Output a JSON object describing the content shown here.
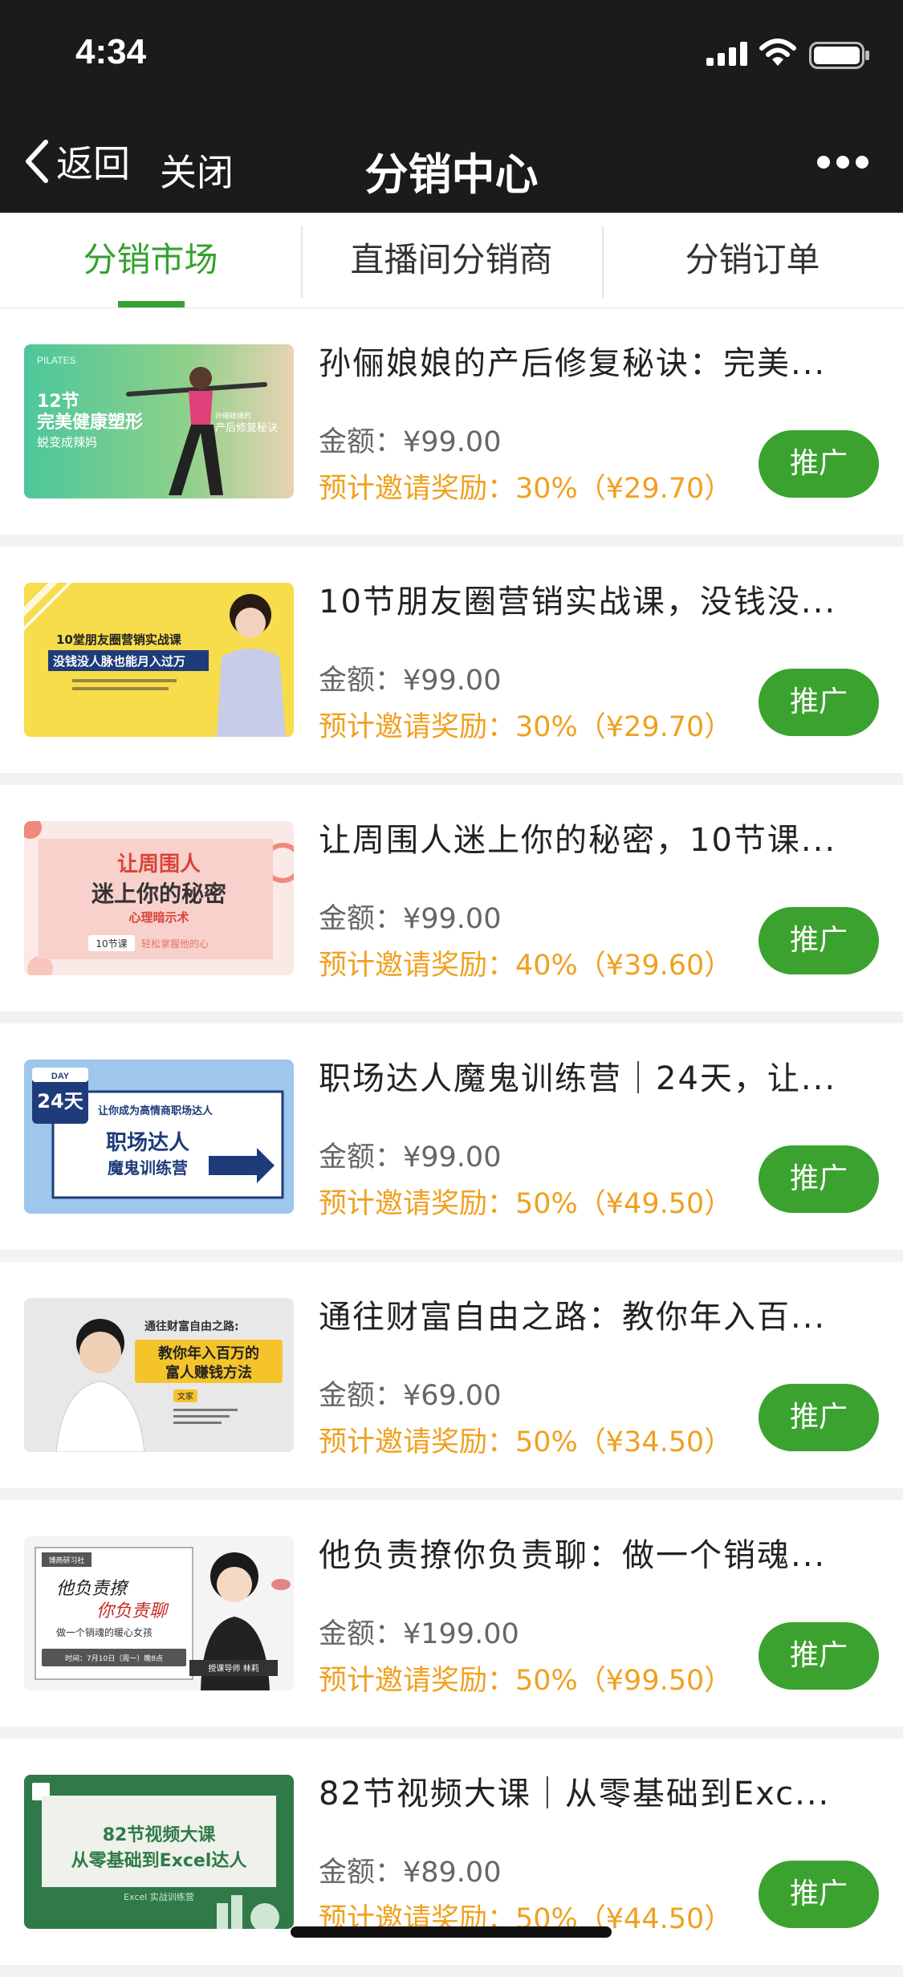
{
  "status": {
    "time": "4:34"
  },
  "nav": {
    "back": "返回",
    "close": "关闭",
    "title": "分销中心"
  },
  "tabs": [
    {
      "label": "分销市场",
      "active": true
    },
    {
      "label": "直播间分销商",
      "active": false
    },
    {
      "label": "分销订单",
      "active": false
    }
  ],
  "products": [
    {
      "title": "孙俪娘娘的产后修复秘诀：完美...",
      "price": "金额：¥99.00",
      "reward": "预计邀请奖励：30%（¥29.70）",
      "button": "推广",
      "thumb": {
        "brand": "PILATES",
        "badge": "12节",
        "line1": "完美健康塑形",
        "line2": "蜕变成辣妈",
        "caption1": "孙俪娘娘的",
        "caption2": "产后修复秘诀"
      }
    },
    {
      "title": "10节朋友圈营销实战课，没钱没...",
      "price": "金额：¥99.00",
      "reward": "预计邀请奖励：30%（¥29.70）",
      "button": "推广",
      "thumb": {
        "line1": "10堂朋友圈营销实战课",
        "line2": "没钱没人脉也能月入过万"
      }
    },
    {
      "title": "让周围人迷上你的秘密，10节课...",
      "price": "金额：¥99.00",
      "reward": "预计邀请奖励：40%（¥39.60）",
      "button": "推广",
      "thumb": {
        "line1": "让周围人",
        "line2": "迷上你的秘密",
        "line3": "心理暗示术",
        "badge": "10节课",
        "line4": "轻松掌握他的心"
      }
    },
    {
      "title": "职场达人魔鬼训练营｜24天，让...",
      "price": "金额：¥99.00",
      "reward": "预计邀请奖励：50%（¥49.50）",
      "button": "推广",
      "thumb": {
        "day": "DAY",
        "num": "24天",
        "line1": "让你成为高情商职场达人",
        "line2": "职场达人",
        "line3": "魔鬼训练营"
      }
    },
    {
      "title": "通往财富自由之路：教你年入百...",
      "price": "金额：¥69.00",
      "reward": "预计邀请奖励：50%（¥34.50）",
      "button": "推广",
      "thumb": {
        "line1": "通往财富自由之路:",
        "line2": "教你年入百万的",
        "line3": "富人赚钱方法",
        "badge": "文家"
      }
    },
    {
      "title": "他负责撩你负责聊：做一个销魂...",
      "price": "金额：¥199.00",
      "reward": "预计邀请奖励：50%（¥99.50）",
      "button": "推广",
      "thumb": {
        "tag": "博商研习社",
        "line1": "他负责撩",
        "line2": "你负责聊",
        "line3": "做一个销魂的暖心女孩",
        "line4": "时间：7月10日（周一）晚8点",
        "line5": "授课导师 林莉"
      }
    },
    {
      "title": "82节视频大课｜从零基础到Exc...",
      "price": "金额：¥89.00",
      "reward": "预计邀请奖励：50%（¥44.50）",
      "button": "推广",
      "thumb": {
        "line1": "82节视频大课",
        "line2": "从零基础到Excel达人",
        "line3": "Excel 实战训练营"
      }
    }
  ],
  "colors": {
    "accent": "#36a12e",
    "reward": "#f0a020",
    "button": "#3ba22f",
    "bar": "#1b1b1d"
  },
  "icons": [
    "signal-icon",
    "wifi-icon",
    "battery-icon",
    "back-chevron-icon",
    "more-icon"
  ]
}
